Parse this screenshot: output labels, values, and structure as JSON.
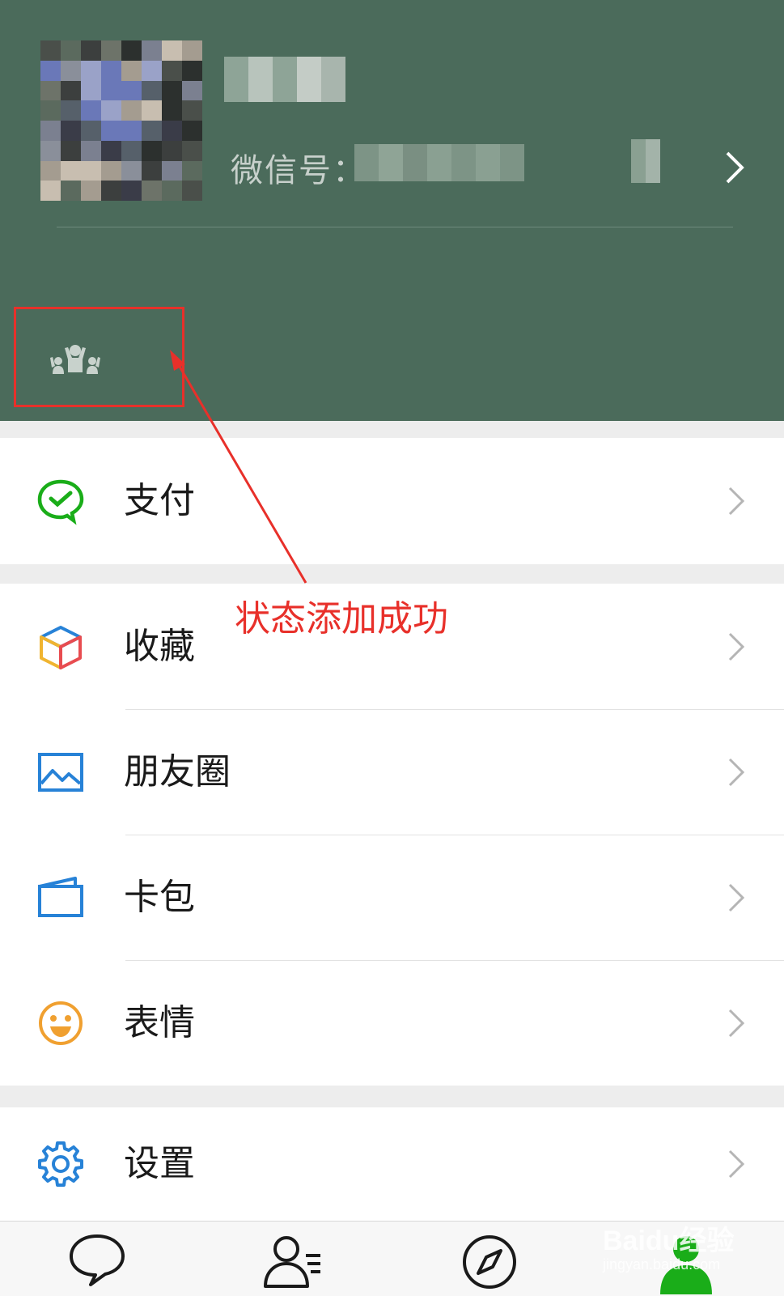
{
  "profile": {
    "wechat_id_label": "微信号："
  },
  "menu": {
    "pay": {
      "label": "支付"
    },
    "favorites": {
      "label": "收藏"
    },
    "moments": {
      "label": "朋友圈"
    },
    "cards": {
      "label": "卡包"
    },
    "stickers": {
      "label": "表情"
    },
    "settings": {
      "label": "设置"
    }
  },
  "annotation": {
    "text": "状态添加成功",
    "color": "#e8302a"
  },
  "tabbar": {
    "active": "me",
    "active_color": "#1aad19"
  },
  "watermark": {
    "main": "Baidu经验",
    "sub": "jingyan.baidu.com"
  },
  "colors": {
    "header_bg": "#4b6b5b",
    "icon_green": "#1aad19",
    "icon_blue": "#2782d7",
    "icon_orange": "#f0a030"
  }
}
